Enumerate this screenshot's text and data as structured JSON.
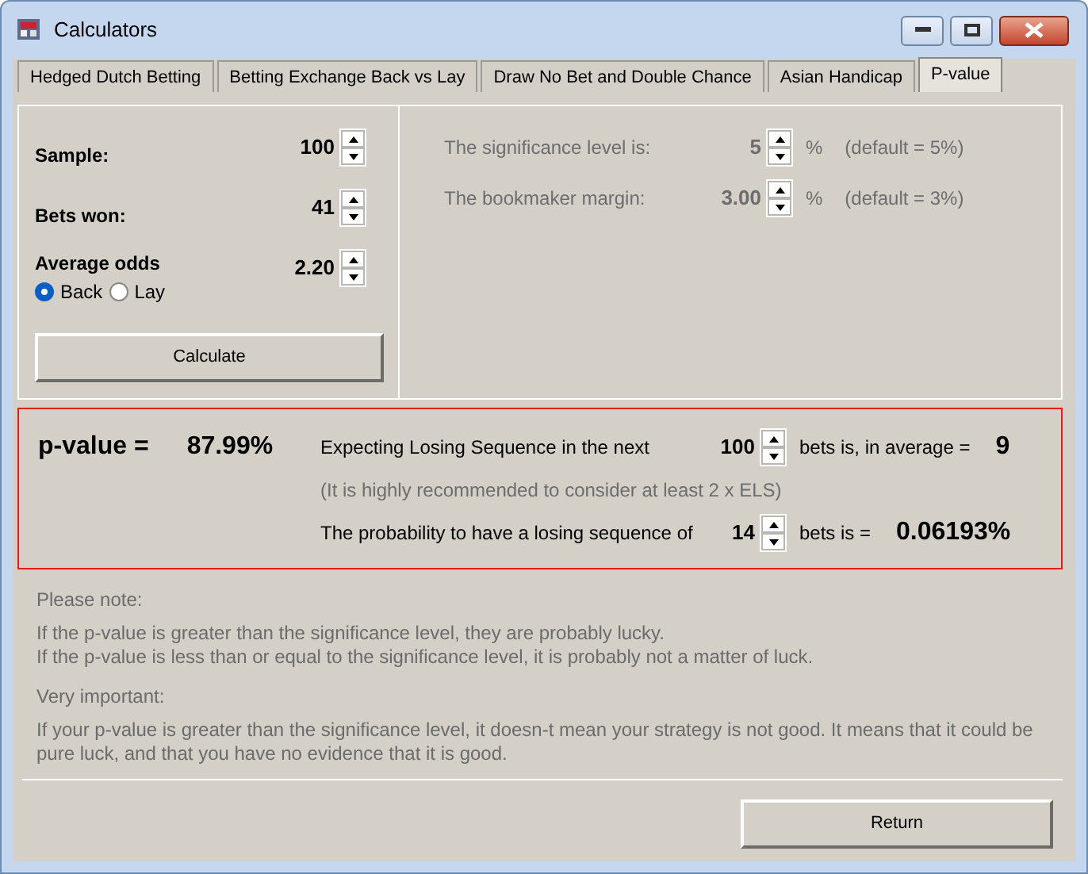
{
  "window": {
    "title": "Calculators"
  },
  "tabs": [
    {
      "label": "Hedged Dutch Betting",
      "selected": false
    },
    {
      "label": "Betting Exchange Back vs Lay",
      "selected": false
    },
    {
      "label": "Draw No Bet and Double Chance",
      "selected": false
    },
    {
      "label": "Asian Handicap",
      "selected": false
    },
    {
      "label": "P-value",
      "selected": true
    }
  ],
  "inputs": [
    {
      "label": "Sample:",
      "value": "100"
    },
    {
      "label": "Bets won:",
      "value": "41"
    },
    {
      "label": "Average odds",
      "value": "2.20"
    }
  ],
  "odds_type": [
    {
      "label": "Back",
      "selected": true
    },
    {
      "label": "Lay",
      "selected": false
    }
  ],
  "calculate_button": "Calculate",
  "settings": [
    {
      "label": "The significance level is:",
      "value": "5",
      "unit": "%",
      "note": "(default = 5%)",
      "disabled": true
    },
    {
      "label": "The bookmaker margin:",
      "value": "3.00",
      "unit": "%",
      "note": "(default = 3%)",
      "disabled": true
    }
  ],
  "result": {
    "label": "p-value =",
    "value": "87.99%",
    "els": {
      "prefix": "Expecting Losing Sequence in the next",
      "value": "100",
      "suffix": "bets is, in average =",
      "result": "9"
    },
    "hint": "(It is highly recommended to consider at least 2 x ELS)",
    "probability": {
      "prefix": "The probability to have a losing sequence of",
      "value": "14",
      "suffix": "bets is =",
      "result": "0.06193%"
    }
  },
  "notes": [
    {
      "heading": "Please note:",
      "lines": [
        "If the p-value is greater than the significance level, they are probably lucky.",
        "If the p-value is less than or equal to the significance level, it is probably not a matter of luck."
      ]
    },
    {
      "heading": "Very important:",
      "lines": [
        "If your p-value is greater than the significance level, it doesn-t mean your strategy is not good. It means that it could be pure luck, and that you have no evidence that it is good."
      ]
    }
  ],
  "return_button": "Return"
}
